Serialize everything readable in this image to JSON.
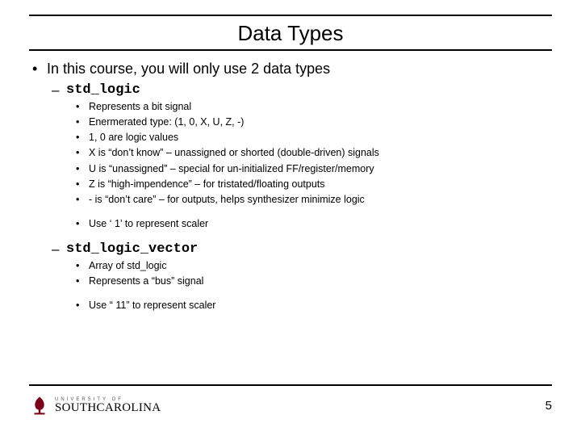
{
  "title": "Data Types",
  "bullet": "In this course, you will only use 2 data types",
  "types": [
    {
      "name": "std_logic",
      "details": [
        "Represents a bit signal",
        "Enermerated type:  (1, 0, X, U, Z, -)",
        "1, 0 are logic values",
        "X is “don’t know” – unassigned or shorted (double-driven) signals",
        "U is “unassigned” – special for un-initialized FF/register/memory",
        "Z is “high-impendence” – for tristated/floating outputs",
        "- is “don’t care” – for outputs, helps synthesizer minimize logic"
      ],
      "note": "Use ‘ 1’ to represent scaler"
    },
    {
      "name": "std_logic_vector",
      "details": [
        "Array of std_logic",
        "Represents a “bus” signal"
      ],
      "note": "Use “ 11” to represent scaler"
    }
  ],
  "footer": {
    "logo_small": "UNIVERSITY OF",
    "logo_big_1": "SOUTH",
    "logo_big_2": "CAROLINA",
    "page": "5"
  }
}
